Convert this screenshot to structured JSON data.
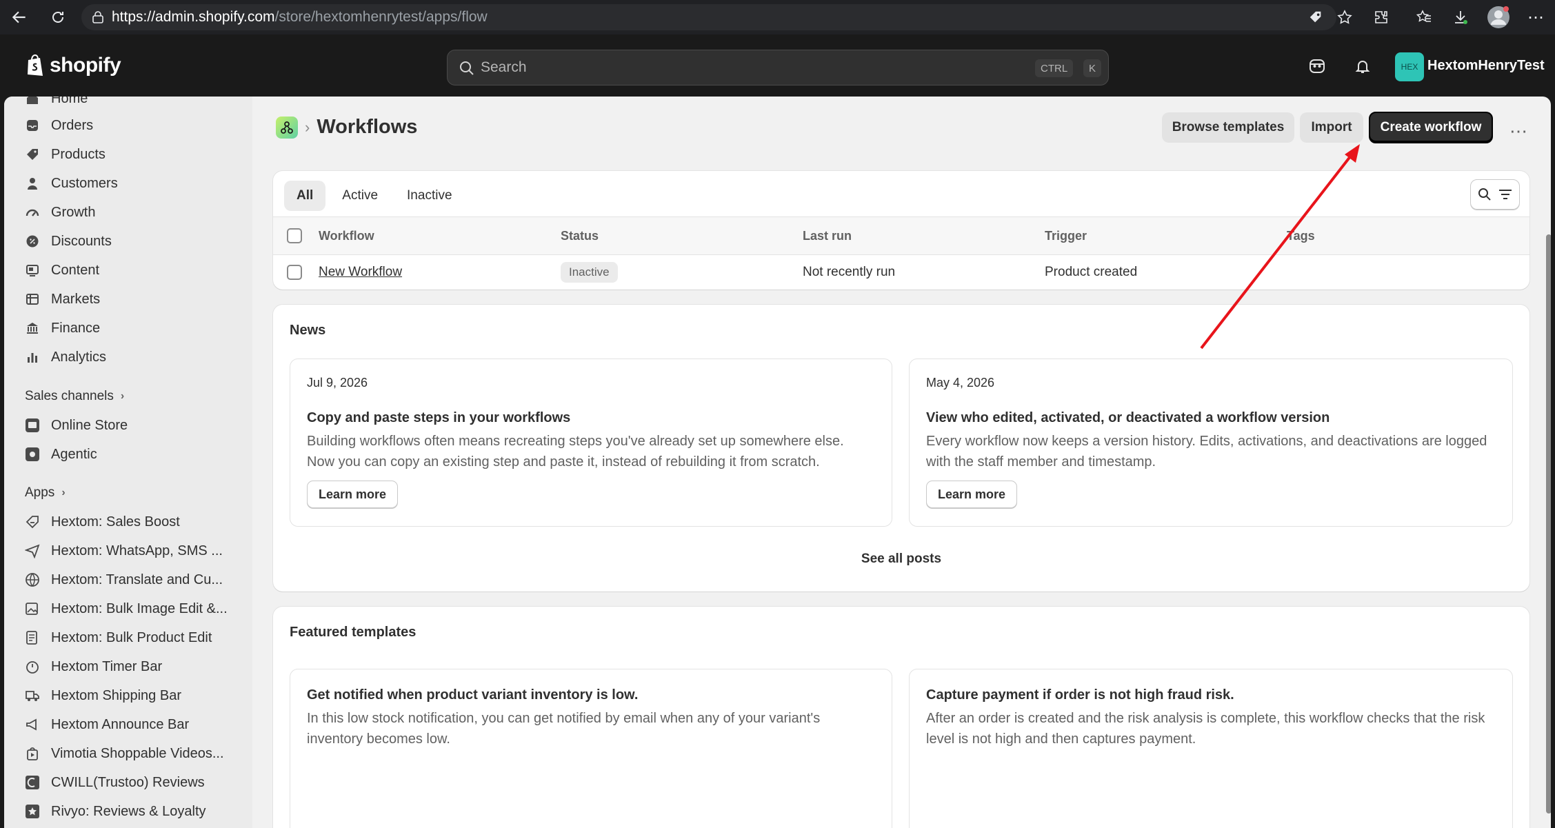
{
  "browser": {
    "url_host": "https://admin.shopify.com",
    "url_path": "/store/hextomhenrytest/apps/flow"
  },
  "topbar": {
    "logo_text": "shopify",
    "search_placeholder": "Search",
    "shortcut_ctrl": "CTRL",
    "shortcut_k": "K",
    "store_avatar": "HEX",
    "store_name": "HextomHenryTest"
  },
  "sidebar": {
    "items": [
      {
        "label": "Home",
        "icon": "home-icon"
      },
      {
        "label": "Orders",
        "icon": "inbox-icon"
      },
      {
        "label": "Products",
        "icon": "tag-icon"
      },
      {
        "label": "Customers",
        "icon": "person-icon"
      },
      {
        "label": "Growth",
        "icon": "gauge-icon"
      },
      {
        "label": "Discounts",
        "icon": "discount-icon"
      },
      {
        "label": "Content",
        "icon": "content-icon"
      },
      {
        "label": "Markets",
        "icon": "globe-icon"
      },
      {
        "label": "Finance",
        "icon": "bank-icon"
      },
      {
        "label": "Analytics",
        "icon": "bar-chart-icon"
      }
    ],
    "sales_channels_label": "Sales channels",
    "channels": [
      {
        "label": "Online Store",
        "icon": "store-icon"
      },
      {
        "label": "Agentic",
        "icon": "agentic-icon"
      }
    ],
    "apps_label": "Apps",
    "apps": [
      {
        "label": "Hextom: Sales Boost",
        "icon": "sales-boost-icon"
      },
      {
        "label": "Hextom: WhatsApp, SMS ...",
        "icon": "send-icon"
      },
      {
        "label": "Hextom: Translate and Cu...",
        "icon": "globe-icon"
      },
      {
        "label": "Hextom: Bulk Image Edit &...",
        "icon": "image-edit-icon"
      },
      {
        "label": "Hextom: Bulk Product Edit",
        "icon": "edit-doc-icon"
      },
      {
        "label": "Hextom Timer Bar",
        "icon": "timer-icon"
      },
      {
        "label": "Hextom Shipping Bar",
        "icon": "truck-icon"
      },
      {
        "label": "Hextom Announce Bar",
        "icon": "megaphone-icon"
      },
      {
        "label": "Vimotia Shoppable Videos...",
        "icon": "video-bag-icon"
      },
      {
        "label": "CWILL(Trustoo) Reviews",
        "icon": "trustoo-icon"
      },
      {
        "label": "Rivyo: Reviews & Loyalty",
        "icon": "rivyo-icon"
      }
    ]
  },
  "page": {
    "title": "Workflows",
    "breadcrumb_sep": "›",
    "browse_templates": "Browse templates",
    "import": "Import",
    "create_workflow": "Create workflow"
  },
  "workflows": {
    "tabs": [
      "All",
      "Active",
      "Inactive"
    ],
    "columns": [
      "Workflow",
      "Status",
      "Last run",
      "Trigger",
      "Tags"
    ],
    "rows": [
      {
        "name": "New Workflow",
        "status": "Inactive",
        "last_run": "Not recently run",
        "trigger": "Product created",
        "tags": ""
      }
    ]
  },
  "news": {
    "title": "News",
    "posts": [
      {
        "date": "Jul 9, 2026",
        "title": "Copy and paste steps in your workflows",
        "body": "Building workflows often means recreating steps you've already set up somewhere else. Now you can copy an existing step and paste it, instead of rebuilding it from scratch.",
        "cta": "Learn more"
      },
      {
        "date": "May 4, 2026",
        "title": "View who edited, activated, or deactivated a workflow version",
        "body": "Every workflow now keeps a version history. Edits, activations, and deactivations are logged with the staff member and timestamp.",
        "cta": "Learn more"
      }
    ],
    "see_all": "See all posts"
  },
  "featured": {
    "title": "Featured templates",
    "templates": [
      {
        "title": "Get notified when product variant inventory is low.",
        "body": "In this low stock notification, you can get notified by email when any of your variant's inventory becomes low."
      },
      {
        "title": "Capture payment if order is not high fraud risk.",
        "body": "After an order is created and the risk analysis is complete, this workflow checks that the risk level is not high and then captures payment."
      }
    ]
  },
  "colors": {
    "annotation_arrow": "#e8141b",
    "primary_button": "#303030",
    "app_icon_gradient_start": "#c6f06a",
    "app_icon_gradient_end": "#5ed0a4"
  }
}
